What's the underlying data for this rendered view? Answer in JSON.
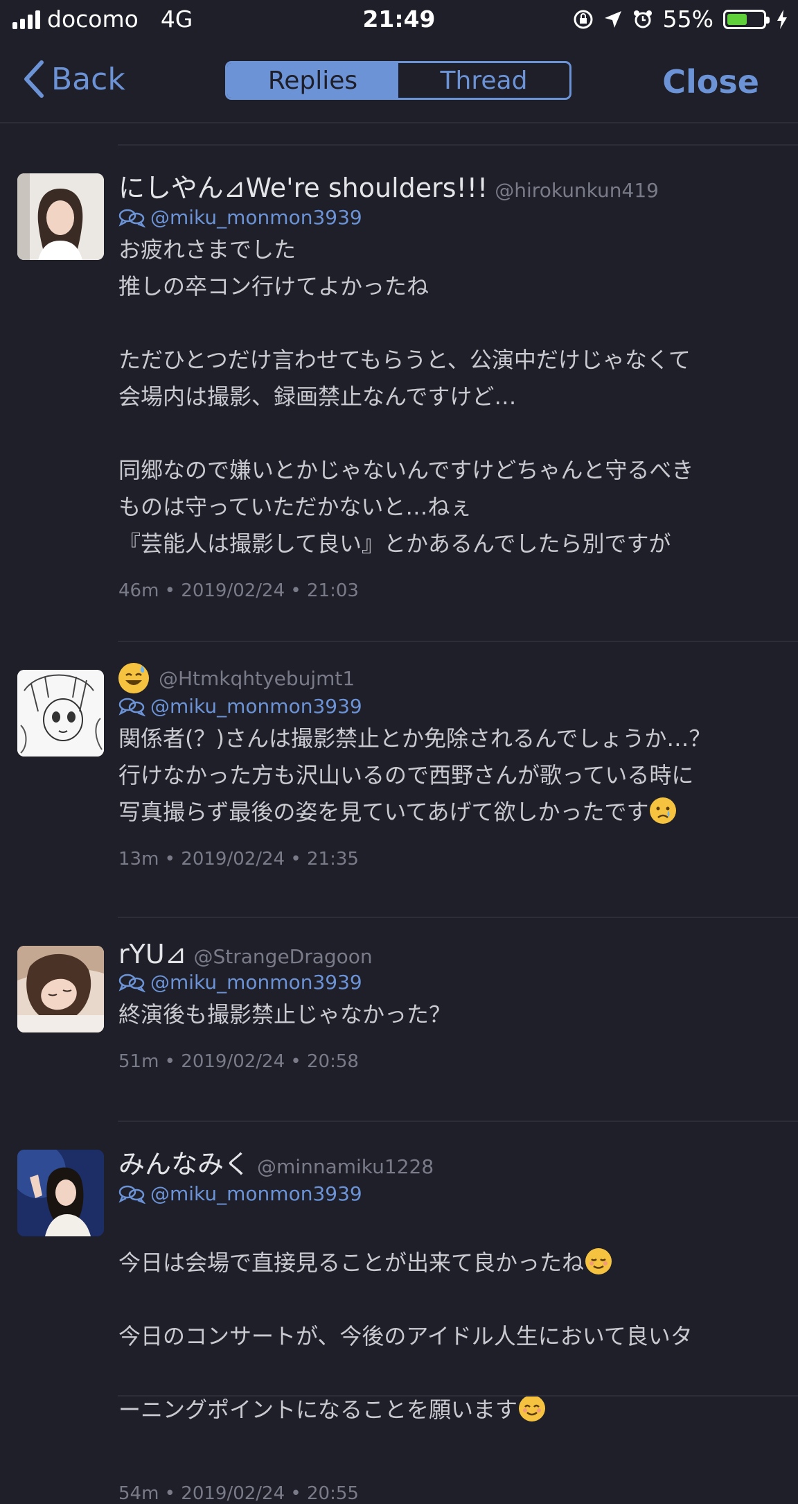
{
  "status_bar": {
    "carrier": "docomo",
    "network": "4G",
    "time": "21:49",
    "battery": "55%",
    "battery_level": 0.55,
    "battery_color": "#5fd03a"
  },
  "nav": {
    "back_label": "Back",
    "tabs": [
      {
        "label": "Replies",
        "active": true
      },
      {
        "label": "Thread",
        "active": false
      }
    ],
    "close_label": "Close",
    "accent": "#6c93d6"
  },
  "tweets": [
    {
      "name": "にしやん⊿We're shoulders!!!",
      "handle": "@hirokunkun419",
      "reply_to": "@miku_monmon3939",
      "body": "お疲れさまでした\n推しの卒コン行けてよかったね\n\nただひとつだけ言わせてもらうと、公演中だけじゃなくて\n会場内は撮影、録画禁止なんですけど…\n\n同郷なので嫌いとかじゃないんですけどちゃんと守るべき\nものは守っていただかないと…ねぇ\n『芸能人は撮影して良い』とかあるんでしたら別ですが",
      "meta": "46m • 2019/02/24 • 21:03"
    },
    {
      "name": "",
      "handle": "@Htmkqhtyebujmt1",
      "reply_to": "@miku_monmon3939",
      "body": "関係者(？)さんは撮影禁止とか免除されるんでしょうか…？\n行けなかった方も沢山いるので西野さんが歌っている時に\n写真撮らず最後の姿を見ていてあげて欲しかったです",
      "meta": "13m • 2019/02/24 • 21:35"
    },
    {
      "name": "rYU⊿",
      "handle": "@StrangeDragoon",
      "reply_to": "@miku_monmon3939",
      "body": "終演後も撮影禁止じゃなかった？",
      "meta": "51m • 2019/02/24 • 20:58"
    },
    {
      "name": "みんなみく",
      "handle": "@minnamiku1228",
      "reply_to": "@miku_monmon3939",
      "body_line1": "今日は会場で直接見ることが出来て良かったね",
      "body_line2": "今日のコンサートが、今後のアイドル人生において良いタ",
      "body_line3": "ーニングポイントになることを願います",
      "meta": "54m • 2019/02/24 • 20:55"
    }
  ]
}
